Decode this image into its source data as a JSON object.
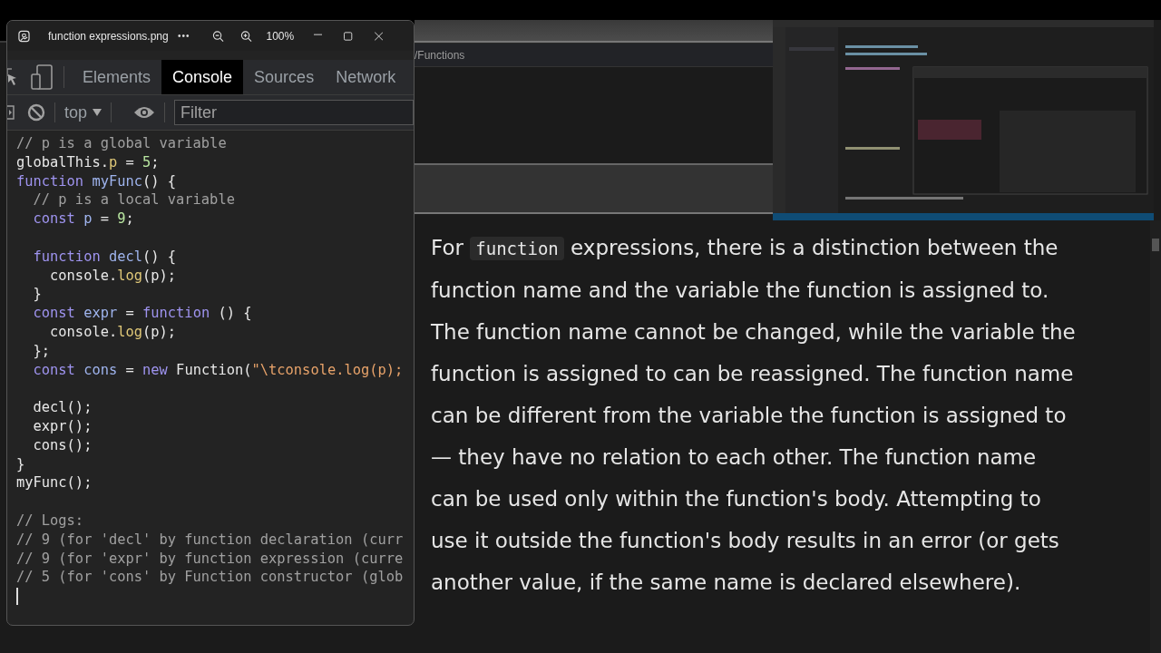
{
  "viewer": {
    "title": "function expressions.png",
    "more": "•••",
    "zoom": "100%"
  },
  "devtools": {
    "tabs": [
      {
        "label": "Elements",
        "selected": false
      },
      {
        "label": "Console",
        "selected": true
      },
      {
        "label": "Sources",
        "selected": false
      },
      {
        "label": "Network",
        "selected": false
      }
    ],
    "context": "top",
    "filter": {
      "placeholder": "Filter"
    },
    "code": [
      [
        [
          {
            "text": "// p is a global variable",
            "kind": "comment"
          }
        ],
        [
          {
            "text": "globalThis.",
            "kind": "plain"
          },
          {
            "text": "p",
            "kind": "prop"
          },
          {
            "text": " = ",
            "kind": "plain"
          },
          {
            "text": "5",
            "kind": "number"
          },
          {
            "text": ";",
            "kind": "plain"
          }
        ],
        [
          {
            "text": "function",
            "kind": "keyword"
          },
          {
            "text": " myFunc",
            "kind": "name"
          },
          {
            "text": "() {",
            "kind": "plain"
          }
        ],
        [
          {
            "text": "  // p is a local variable",
            "kind": "comment"
          }
        ],
        [
          {
            "text": "  const",
            "kind": "keyword"
          },
          {
            "text": " p",
            "kind": "name"
          },
          {
            "text": " = ",
            "kind": "plain"
          },
          {
            "text": "9",
            "kind": "number"
          },
          {
            "text": ";",
            "kind": "plain"
          }
        ]
      ],
      [
        [
          {
            "text": "  function",
            "kind": "keyword"
          },
          {
            "text": " decl",
            "kind": "name"
          },
          {
            "text": "() {",
            "kind": "plain"
          }
        ],
        [
          {
            "text": "    console.",
            "kind": "plain"
          },
          {
            "text": "log",
            "kind": "prop"
          },
          {
            "text": "(p);",
            "kind": "plain"
          }
        ],
        [
          {
            "text": "  }",
            "kind": "plain"
          }
        ],
        [
          {
            "text": "  const",
            "kind": "keyword"
          },
          {
            "text": " expr",
            "kind": "name"
          },
          {
            "text": " = ",
            "kind": "plain"
          },
          {
            "text": "function",
            "kind": "keyword"
          },
          {
            "text": " () {",
            "kind": "plain"
          }
        ],
        [
          {
            "text": "    console.",
            "kind": "plain"
          },
          {
            "text": "log",
            "kind": "prop"
          },
          {
            "text": "(p);",
            "kind": "plain"
          }
        ],
        [
          {
            "text": "  };",
            "kind": "plain"
          }
        ],
        [
          {
            "text": "  const",
            "kind": "keyword"
          },
          {
            "text": " cons",
            "kind": "name"
          },
          {
            "text": " = ",
            "kind": "plain"
          },
          {
            "text": "new",
            "kind": "keyword"
          },
          {
            "text": " Function(",
            "kind": "plain"
          },
          {
            "text": "\"\\tconsole.log(p);",
            "kind": "string"
          }
        ]
      ],
      [
        [
          {
            "text": "  decl();",
            "kind": "plain"
          }
        ],
        [
          {
            "text": "  expr();",
            "kind": "plain"
          }
        ],
        [
          {
            "text": "  cons();",
            "kind": "plain"
          }
        ],
        [
          {
            "text": "}",
            "kind": "plain"
          }
        ],
        [
          {
            "text": "myFunc();",
            "kind": "plain"
          }
        ]
      ],
      [
        [
          {
            "text": "// Logs:",
            "kind": "comment"
          }
        ],
        [
          {
            "text": "// 9 (for 'decl' by function declaration (curr",
            "kind": "comment"
          }
        ],
        [
          {
            "text": "// 9 (for 'expr' by function expression (curre",
            "kind": "comment"
          }
        ],
        [
          {
            "text": "// 5 (for 'cons' by Function constructor (glob",
            "kind": "comment"
          }
        ]
      ]
    ]
  },
  "background": {
    "path": "/Functions"
  },
  "article": {
    "lead": "For",
    "code": "function",
    "text": "expressions, there is a distinction between the function name and the variable the function is assigned to. The function name cannot be changed, while the variable the function is assigned to can be reassigned. The function name can be different from the variable the function is assigned to — they have no relation to each other. The function name can be used only within the function's body. Attempting to use it outside the function's body results in an error (or gets another value, if the same name is declared elsewhere)."
  }
}
